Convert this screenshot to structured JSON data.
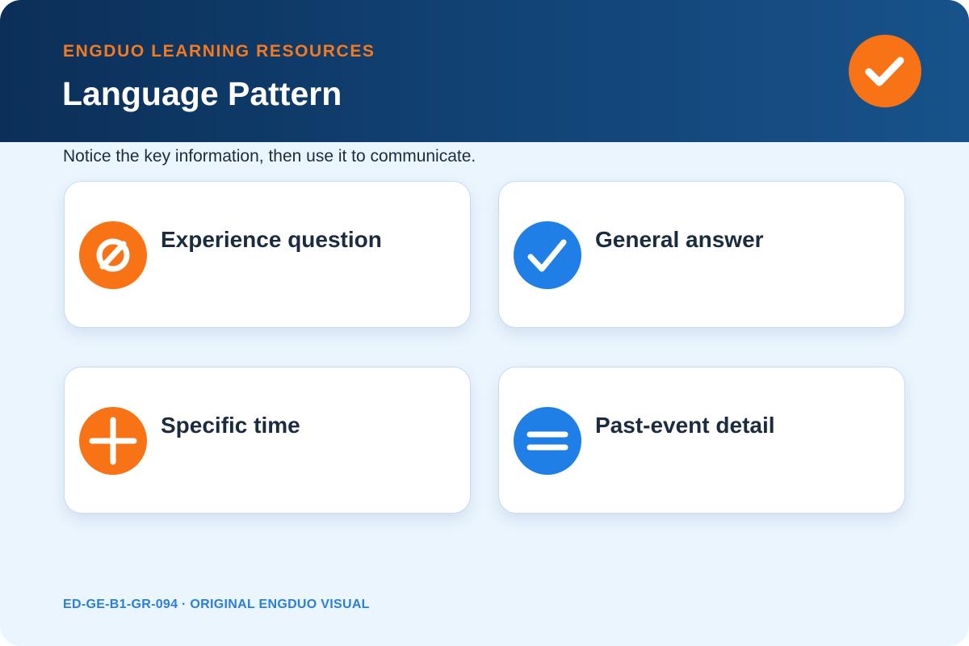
{
  "header": {
    "brand": "ENGDUO LEARNING RESOURCES",
    "title": "Language Pattern",
    "badge_icon": "checkmark-icon"
  },
  "subtitle": "Notice the key information, then use it to communicate.",
  "cards": [
    {
      "label": "Experience question",
      "icon": "slashed-circle-icon",
      "color": "#f87315"
    },
    {
      "label": "General answer",
      "icon": "checkmark-icon",
      "color": "#1f7fe6"
    },
    {
      "label": "Specific time",
      "icon": "plus-icon",
      "color": "#f87315"
    },
    {
      "label": "Past-event detail",
      "icon": "equals-icon",
      "color": "#1f7fe6"
    }
  ],
  "footer": "ED-GE-B1-GR-094 · ORIGINAL ENGDUO VISUAL",
  "colors": {
    "header_dark": "#0b2f58",
    "header_light": "#17528a",
    "accent_orange": "#f87315",
    "accent_blue": "#1f7fe6",
    "background": "#ebf5fe"
  }
}
